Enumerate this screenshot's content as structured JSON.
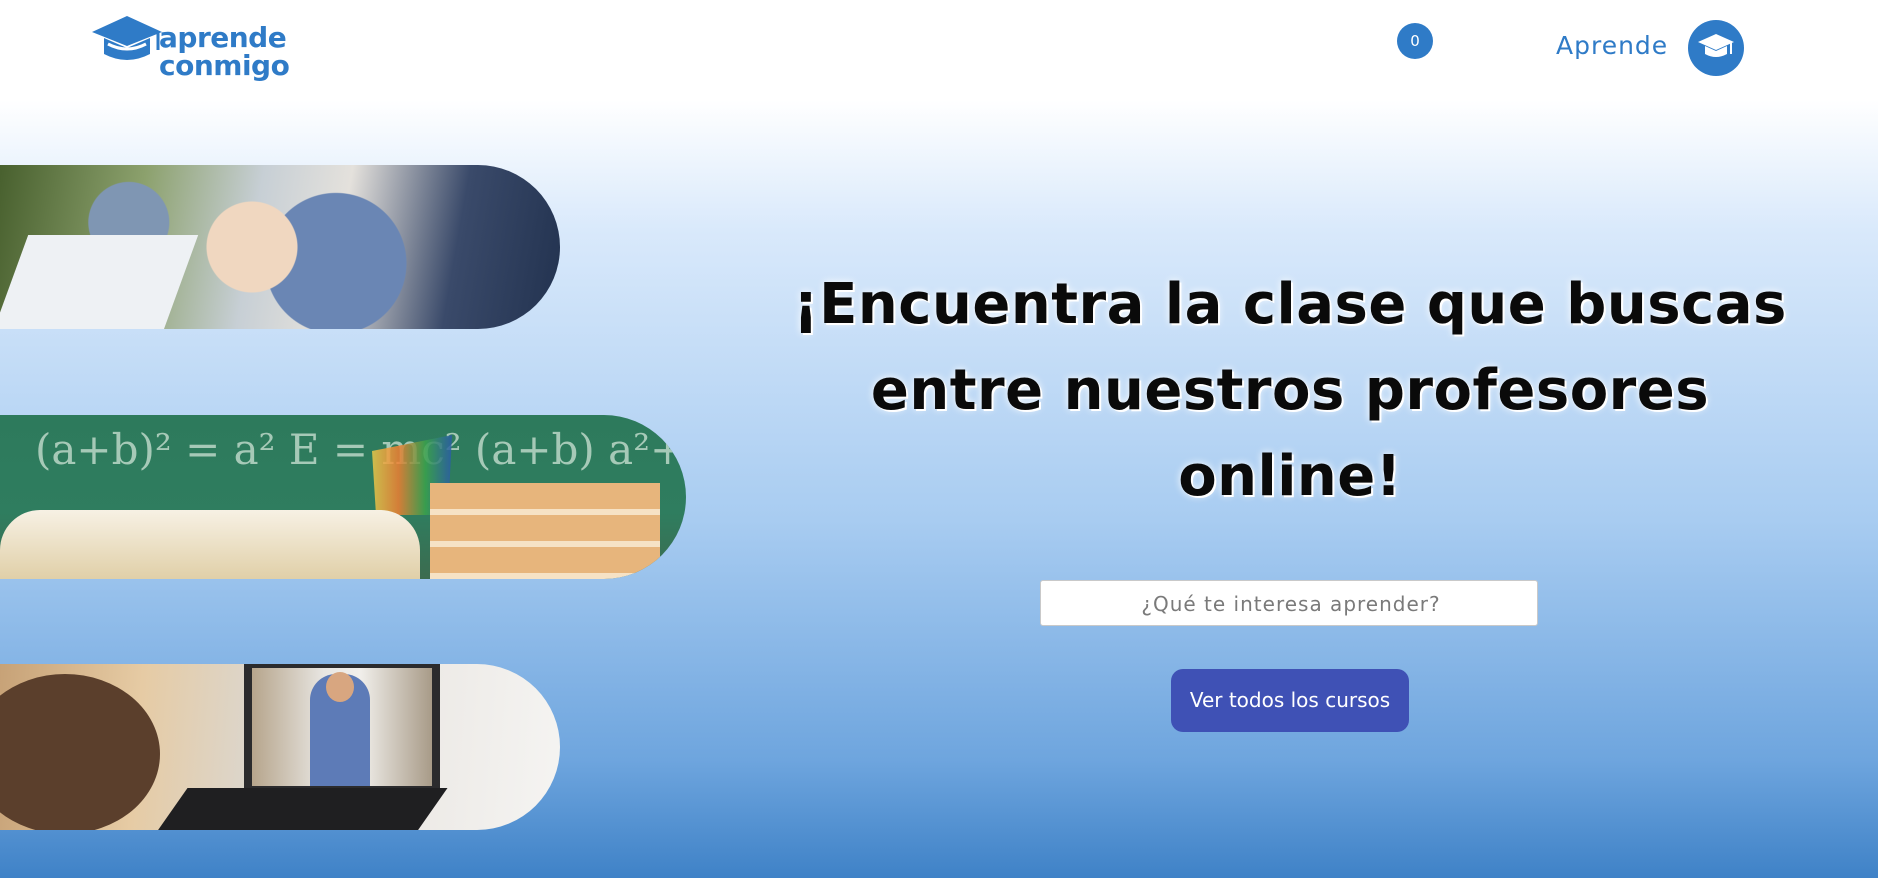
{
  "header": {
    "logo": {
      "line1": "aprende",
      "line2": "conmigo",
      "icon": "graduation-cap-icon"
    },
    "cart_count": "0",
    "nav_label": "Aprende",
    "avatar_icon": "graduation-cap-icon"
  },
  "hero": {
    "title": "¡Encuentra la clase que buscas entre nuestros profesores online!",
    "search_placeholder": "¿Qué te interesa aprender?",
    "cta_label": "Ver todos los cursos"
  },
  "photos": [
    {
      "name": "students-with-phones-photo"
    },
    {
      "name": "books-and-chalkboard-photo"
    },
    {
      "name": "online-class-laptop-photo"
    }
  ],
  "colors": {
    "brand": "#2f7bc7",
    "cta": "#3f51b5",
    "title": "#0a0a0a"
  }
}
